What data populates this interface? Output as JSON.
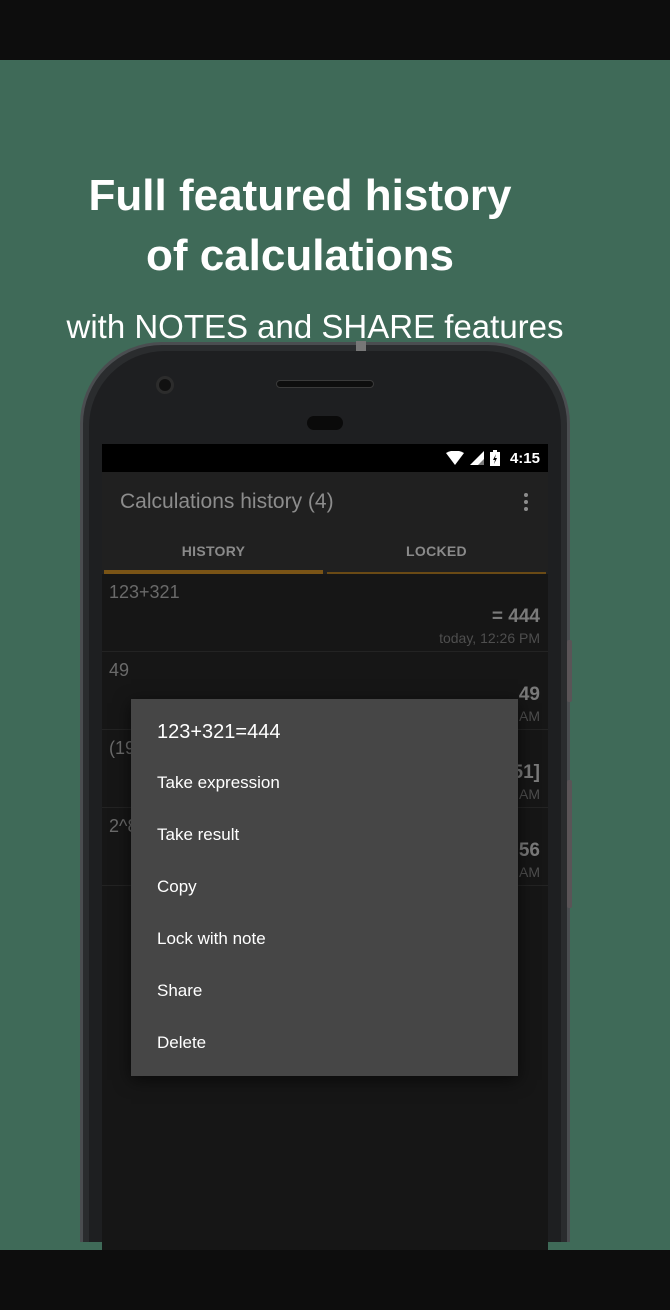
{
  "promo": {
    "headline_line1": "Full featured history",
    "headline_line2": "of calculations",
    "subline": "with NOTES and SHARE features"
  },
  "status_bar": {
    "time": "4:15",
    "icons": [
      "wifi-icon",
      "signal-icon",
      "battery-icon"
    ]
  },
  "app_bar": {
    "title": "Calculations history (4)",
    "menu_icon": "overflow-menu-icon"
  },
  "tabs": [
    {
      "label": "HISTORY",
      "selected": true
    },
    {
      "label": "LOCKED",
      "selected": false
    }
  ],
  "history_items": [
    {
      "expression": "123+321",
      "result": "= 444",
      "time": "today, 12:26 PM"
    },
    {
      "expression": "49",
      "result": "49",
      "time": "AM"
    },
    {
      "expression": "(19",
      "result": "51]",
      "time": "AM"
    },
    {
      "expression": "2^8",
      "result": "56",
      "time": "AM"
    }
  ],
  "context_menu": {
    "title": "123+321=444",
    "items": [
      "Take expression",
      "Take result",
      "Copy",
      "Lock with note",
      "Share",
      "Delete"
    ]
  },
  "colors": {
    "background": "#3f6a58",
    "tab_indicator": "#7a5416",
    "menu_background": "#464646"
  }
}
